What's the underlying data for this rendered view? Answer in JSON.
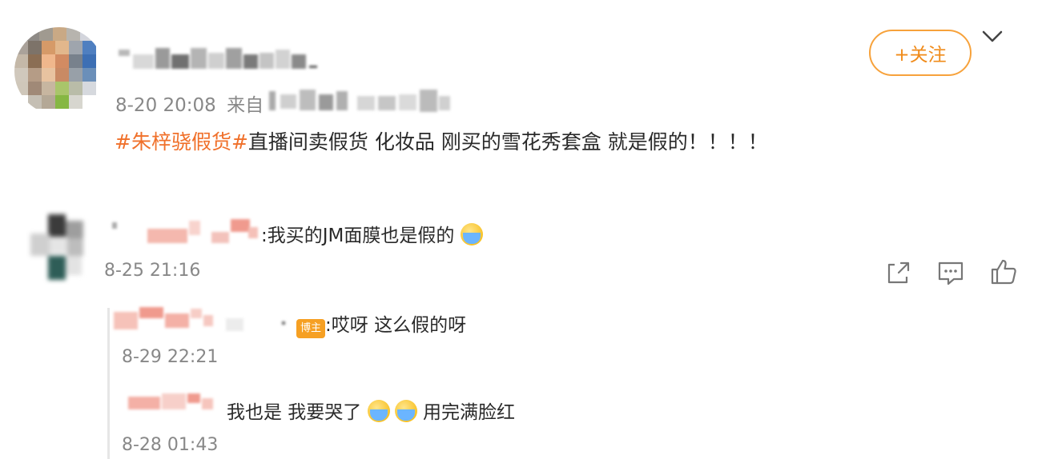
{
  "post": {
    "follow_label": "+关注",
    "timestamp": "8-20 20:08",
    "source_prefix": "来自",
    "hashtag": "#朱梓骁假货#",
    "body": "直播间卖假货 化妆品 刚买的雪花秀套盒 就是假的！！！！"
  },
  "comment": {
    "text": ":我买的JM面膜也是假的",
    "timestamp": "8-25 21:16",
    "actions": [
      "share-icon",
      "comment-icon",
      "like-icon"
    ]
  },
  "replies": [
    {
      "badge": "博主",
      "text": ":哎呀 这么假的呀",
      "timestamp": "8-29 22:21"
    },
    {
      "text_a": "我也是 我要哭了",
      "text_b": "用完满脸红",
      "timestamp": "8-28 01:43"
    }
  ],
  "colors": {
    "accent": "#f08b1a",
    "hashtag": "#f0702a",
    "badge": "#f6a023"
  }
}
